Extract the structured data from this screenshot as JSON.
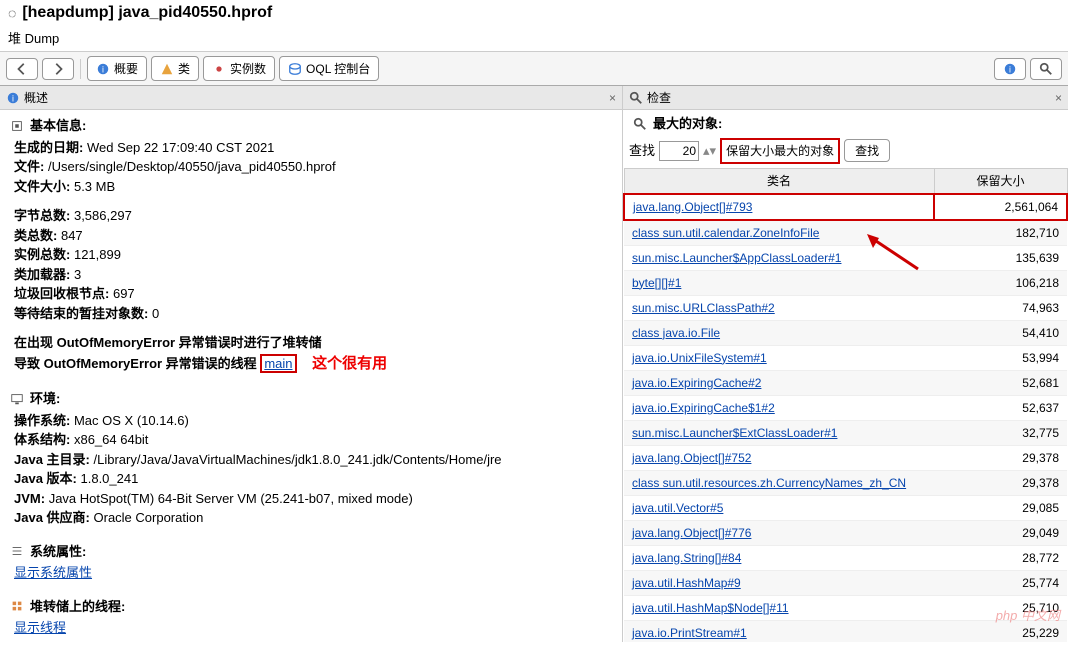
{
  "title": "[heapdump] java_pid40550.hprof",
  "subtitle": "堆 Dump",
  "toolbar": {
    "summary": "概要",
    "classes": "类",
    "instances": "实例数",
    "oql": "OQL 控制台"
  },
  "left": {
    "header": "概述",
    "basic": {
      "title": "基本信息:",
      "date_label": "生成的日期:",
      "date_value": "Wed Sep 22 17:09:40 CST 2021",
      "file_label": "文件:",
      "file_value": "/Users/single/Desktop/40550/java_pid40550.hprof",
      "size_label": "文件大小:",
      "size_value": "5.3 MB",
      "bytes_label": "字节总数:",
      "bytes_value": "3,586,297",
      "classes_label": "类总数:",
      "classes_value": "847",
      "instances_label": "实例总数:",
      "instances_value": "121,899",
      "loaders_label": "类加载器:",
      "loaders_value": "3",
      "gcroots_label": "垃圾回收根节点:",
      "gcroots_value": "697",
      "pending_label": "等待结束的暂挂对象数:",
      "pending_value": "0",
      "oom1": "在出现 OutOfMemoryError 异常错误时进行了堆转储",
      "oom2_pre": "导致 OutOfMemoryError 异常错误的线程",
      "oom2_link": "main",
      "annotation": "这个很有用"
    },
    "env": {
      "title": "环境:",
      "os_label": "操作系统:",
      "os_value": "Mac OS X (10.14.6)",
      "arch_label": "体系结构:",
      "arch_value": "x86_64 64bit",
      "home_label": "Java 主目录:",
      "home_value": "/Library/Java/JavaVirtualMachines/jdk1.8.0_241.jdk/Contents/Home/jre",
      "ver_label": "Java 版本:",
      "ver_value": "1.8.0_241",
      "jvm_label": "JVM:",
      "jvm_value": "Java HotSpot(TM) 64-Bit Server VM (25.241-b07, mixed mode)",
      "vendor_label": "Java 供应商:",
      "vendor_value": "Oracle Corporation"
    },
    "sysprops": {
      "title": "系统属性:",
      "link": "显示系统属性"
    },
    "threads": {
      "title": "堆转储上的线程:",
      "link": "显示线程"
    }
  },
  "right": {
    "header": "检查",
    "largest": "最大的对象:",
    "search_label": "查找",
    "search_value": "20",
    "select_value": "保留大小最大的对象",
    "search_btn": "查找",
    "col_class": "类名",
    "col_size": "保留大小",
    "rows": [
      {
        "name": "java.lang.Object[]#793",
        "size": "2,561,064",
        "hl": true
      },
      {
        "name": "class sun.util.calendar.ZoneInfoFile",
        "size": "182,710"
      },
      {
        "name": "sun.misc.Launcher$AppClassLoader#1",
        "size": "135,639"
      },
      {
        "name": "byte[][]#1",
        "size": "106,218"
      },
      {
        "name": "sun.misc.URLClassPath#2",
        "size": "74,963"
      },
      {
        "name": "class java.io.File",
        "size": "54,410"
      },
      {
        "name": "java.io.UnixFileSystem#1",
        "size": "53,994"
      },
      {
        "name": "java.io.ExpiringCache#2",
        "size": "52,681"
      },
      {
        "name": "java.io.ExpiringCache$1#2",
        "size": "52,637"
      },
      {
        "name": "sun.misc.Launcher$ExtClassLoader#1",
        "size": "32,775"
      },
      {
        "name": "java.lang.Object[]#752",
        "size": "29,378"
      },
      {
        "name": "class sun.util.resources.zh.CurrencyNames_zh_CN",
        "size": "29,378"
      },
      {
        "name": "java.util.Vector#5",
        "size": "29,085"
      },
      {
        "name": "java.lang.Object[]#776",
        "size": "29,049"
      },
      {
        "name": "java.lang.String[]#84",
        "size": "28,772"
      },
      {
        "name": "java.util.HashMap#9",
        "size": "25,774"
      },
      {
        "name": "java.util.HashMap$Node[]#11",
        "size": "25,710"
      },
      {
        "name": "java.io.PrintStream#1",
        "size": "25,229"
      }
    ]
  },
  "watermark": "php 中文网"
}
